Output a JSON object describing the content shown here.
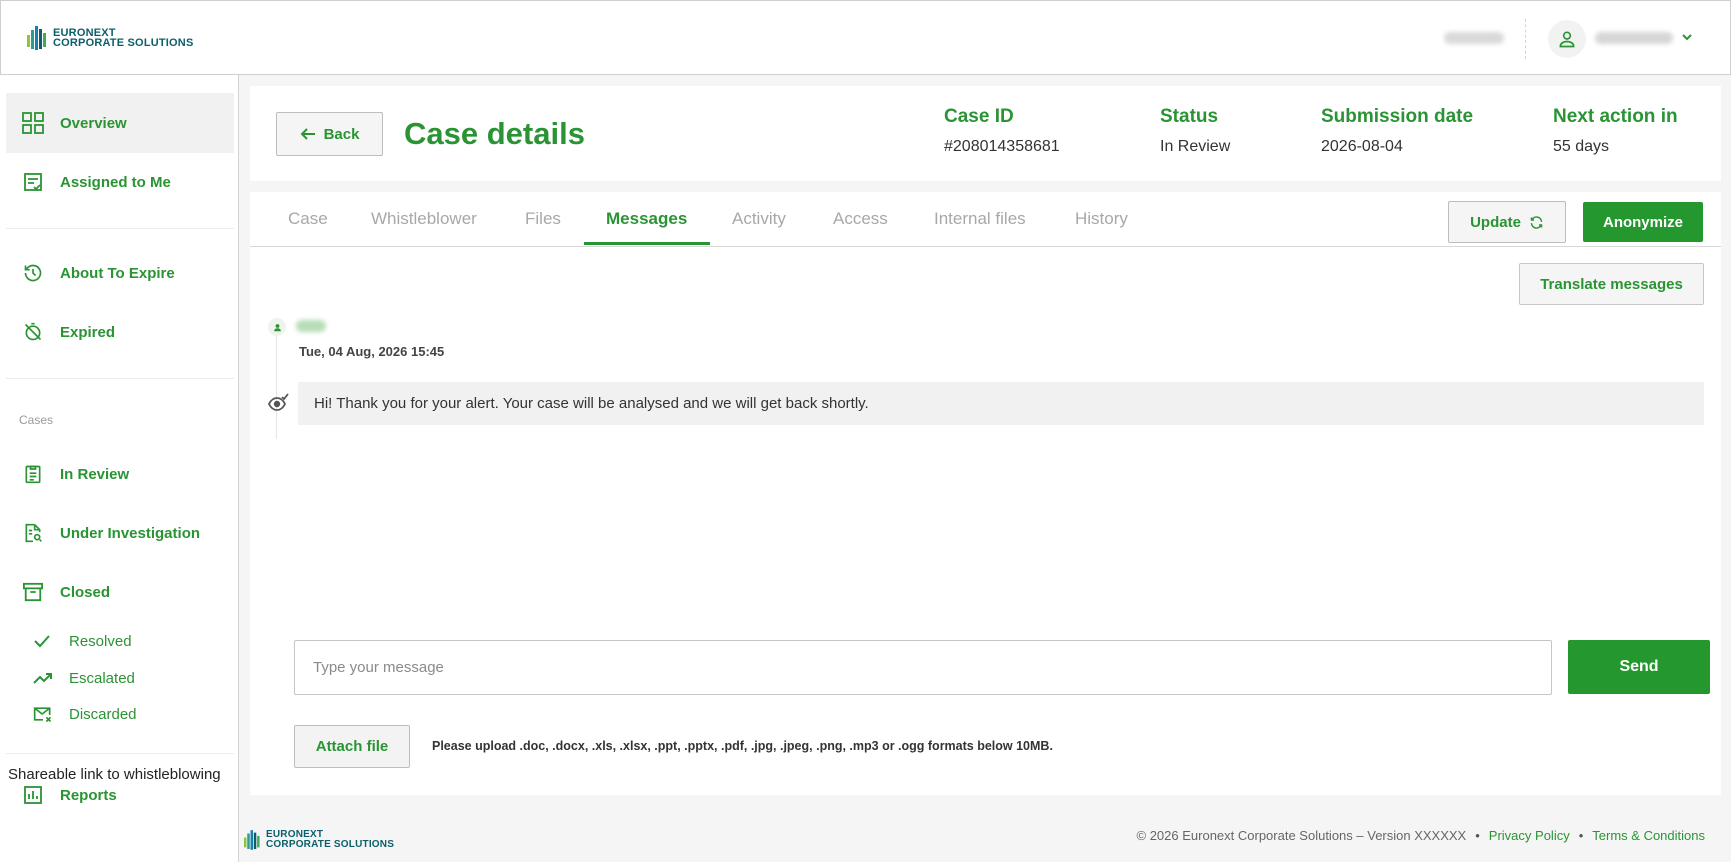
{
  "brand": {
    "line1": "EURONEXT",
    "line2": "CORPORATE SOLUTIONS"
  },
  "colors": {
    "accent": "#2a9434",
    "button_primary": "#24972f",
    "brand_teal": "#0a5f6a"
  },
  "sidebar": {
    "items": [
      {
        "label": "Overview",
        "icon": "grid-icon"
      },
      {
        "label": "Assigned to Me",
        "icon": "assigned-icon"
      },
      {
        "label": "About To Expire",
        "icon": "history-icon"
      },
      {
        "label": "Expired",
        "icon": "timer-off-icon"
      },
      {
        "label": "In Review",
        "icon": "clipboard-icon"
      },
      {
        "label": "Under Investigation",
        "icon": "document-search-icon"
      },
      {
        "label": "Closed",
        "icon": "archive-icon"
      },
      {
        "label": "Reports",
        "icon": "bar-chart-icon"
      }
    ],
    "section_label": "Cases",
    "sub_items": [
      {
        "label": "Resolved",
        "icon": "check-icon"
      },
      {
        "label": "Escalated",
        "icon": "trending-up-icon"
      },
      {
        "label": "Discarded",
        "icon": "mail-x-icon"
      }
    ],
    "share_link": "Shareable link to whistleblowing"
  },
  "header": {
    "back_label": "Back",
    "title": "Case details",
    "meta": [
      {
        "label": "Case ID",
        "value": "#208014358681"
      },
      {
        "label": "Status",
        "value": "In Review"
      },
      {
        "label": "Submission date",
        "value": "2026-08-04"
      },
      {
        "label": "Next action in",
        "value": "55 days"
      }
    ]
  },
  "tabs": [
    "Case",
    "Whistleblower",
    "Files",
    "Messages",
    "Activity",
    "Access",
    "Internal files",
    "History"
  ],
  "active_tab": "Messages",
  "actions": {
    "update": "Update",
    "anonymize": "Anonymize",
    "translate": "Translate messages"
  },
  "messages": [
    {
      "timestamp": "Tue, 04 Aug, 2026 15:45",
      "text": "Hi! Thank you for your alert. Your case will be analysed and we will get back shortly."
    }
  ],
  "composer": {
    "placeholder": "Type your message",
    "value": "",
    "send": "Send",
    "attach": "Attach file",
    "hint": "Please upload .doc, .docx, .xls, .xlsx, .ppt, .pptx, .pdf, .jpg, .jpeg, .png, .mp3 or .ogg formats below 10MB."
  },
  "footer": {
    "copyright": "© 2026 Euronext Corporate Solutions – Version XXXXXX",
    "privacy": "Privacy Policy",
    "terms": "Terms & Conditions"
  }
}
